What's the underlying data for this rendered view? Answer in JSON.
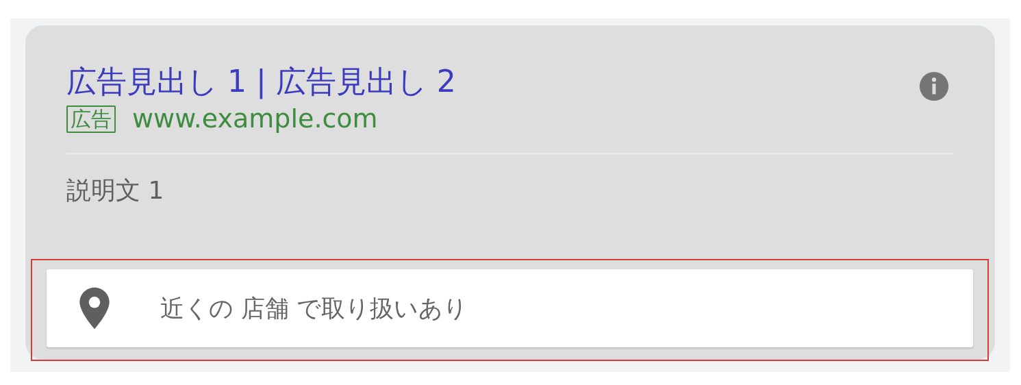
{
  "ad": {
    "headline": "広告見出し 1 | 広告見出し 2",
    "badge": "広告",
    "url": "www.example.com",
    "description": "説明文 1"
  },
  "extension": {
    "text": "近くの 店舗 で取り扱いあり",
    "highlighted": true
  }
}
